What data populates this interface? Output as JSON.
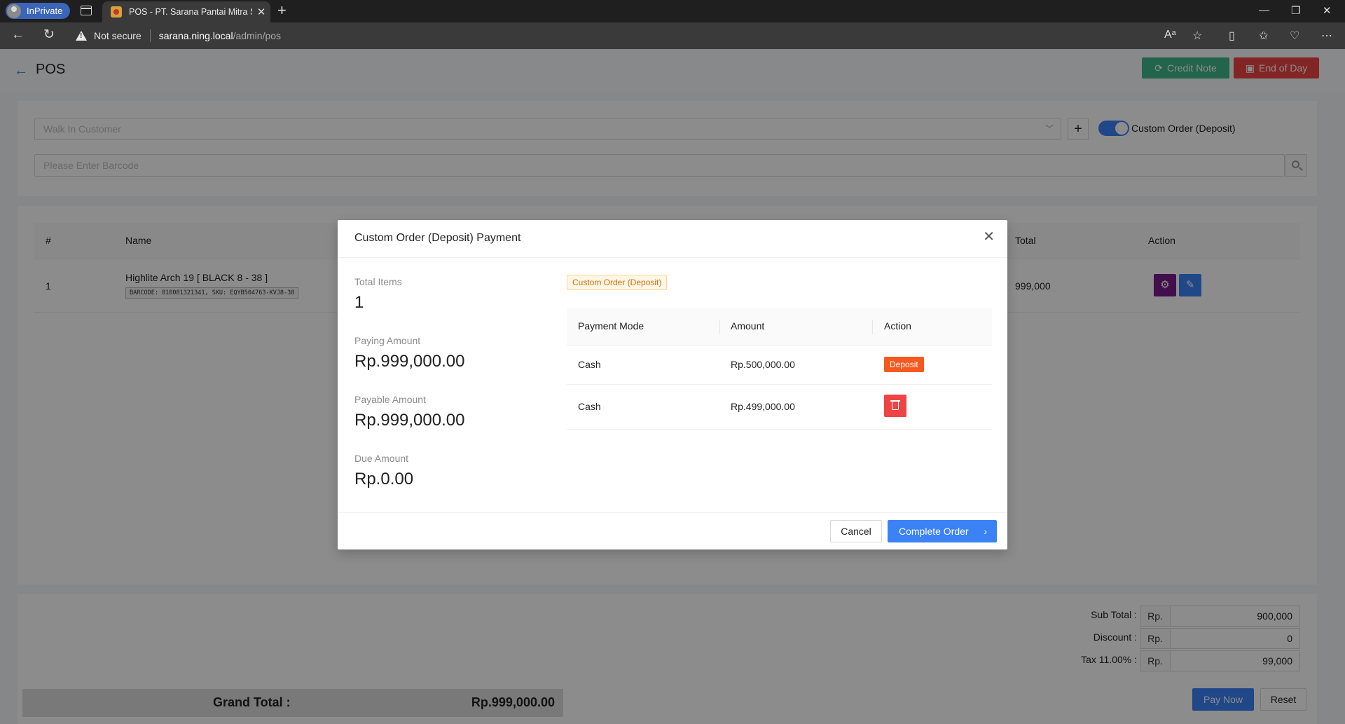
{
  "browser": {
    "inprivate_label": "InPrivate",
    "tab_title": "POS - PT. Sarana Pantai Mitra Se",
    "security_label": "Not secure",
    "url_host": "sarana.ning.local",
    "url_path": "/admin/pos"
  },
  "header": {
    "title": "POS",
    "credit_note_label": "Credit Note",
    "end_of_day_label": "End of Day"
  },
  "filters": {
    "customer_placeholder": "Walk In Customer",
    "custom_order_label": "Custom Order (Deposit)",
    "custom_order_enabled": true,
    "barcode_placeholder": "Please Enter Barcode"
  },
  "items_table": {
    "columns": {
      "index": "#",
      "name": "Name",
      "total": "Total",
      "action": "Action"
    },
    "rows": [
      {
        "index": "1",
        "name": "Highlite Arch 19 [ BLACK 8 - 38 ]",
        "codes": "BARCODE: 810081321341, SKU: EQYB504763-KVJ8-38",
        "total": "999,000"
      }
    ]
  },
  "totals": {
    "subtotal_label": "Sub Total :",
    "discount_label": "Discount :",
    "tax_label": "Tax 11.00% :",
    "currency_prefix": "Rp.",
    "subtotal": "900,000",
    "discount": "0",
    "tax": "99,000",
    "grand_total_label": "Grand Total :",
    "grand_total": "Rp.999,000.00",
    "pay_now_label": "Pay Now",
    "reset_label": "Reset"
  },
  "modal": {
    "title": "Custom Order (Deposit) Payment",
    "total_items_label": "Total Items",
    "total_items": "1",
    "paying_amount_label": "Paying Amount",
    "paying_amount": "Rp.999,000.00",
    "payable_amount_label": "Payable Amount",
    "payable_amount": "Rp.999,000.00",
    "due_amount_label": "Due Amount",
    "due_amount": "Rp.0.00",
    "tag": "Custom Order (Deposit)",
    "payments_columns": {
      "mode": "Payment Mode",
      "amount": "Amount",
      "action": "Action"
    },
    "payments": [
      {
        "mode": "Cash",
        "amount": "Rp.500,000.00",
        "action_badge": "Deposit"
      },
      {
        "mode": "Cash",
        "amount": "Rp.499,000.00"
      }
    ],
    "cancel_label": "Cancel",
    "complete_label": "Complete Order"
  },
  "colors": {
    "primary": "#3b82f6",
    "danger": "#ef4444",
    "success": "#3fb78a",
    "deposit_badge": "#f5591f",
    "settings_button": "#7a1a8a"
  }
}
